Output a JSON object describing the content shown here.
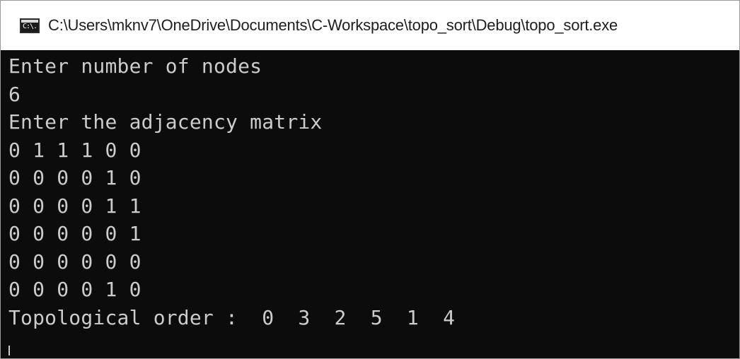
{
  "window": {
    "title": "C:\\Users\\mknv7\\OneDrive\\Documents\\C-Workspace\\topo_sort\\Debug\\topo_sort.exe",
    "icon_label": "C:\\.",
    "icon_name": "console-app-icon"
  },
  "console": {
    "lines": [
      "Enter number of nodes",
      "6",
      "Enter the adjacency matrix",
      "0 1 1 1 0 0",
      "0 0 0 0 1 0",
      "0 0 0 0 1 1",
      "0 0 0 0 0 1",
      "0 0 0 0 0 0",
      "0 0 0 0 1 0",
      "Topological order :  0  3  2  5  1  4"
    ]
  },
  "colors": {
    "background": "#0c0c0c",
    "text": "#cccccc",
    "titlebar": "#ffffff"
  }
}
